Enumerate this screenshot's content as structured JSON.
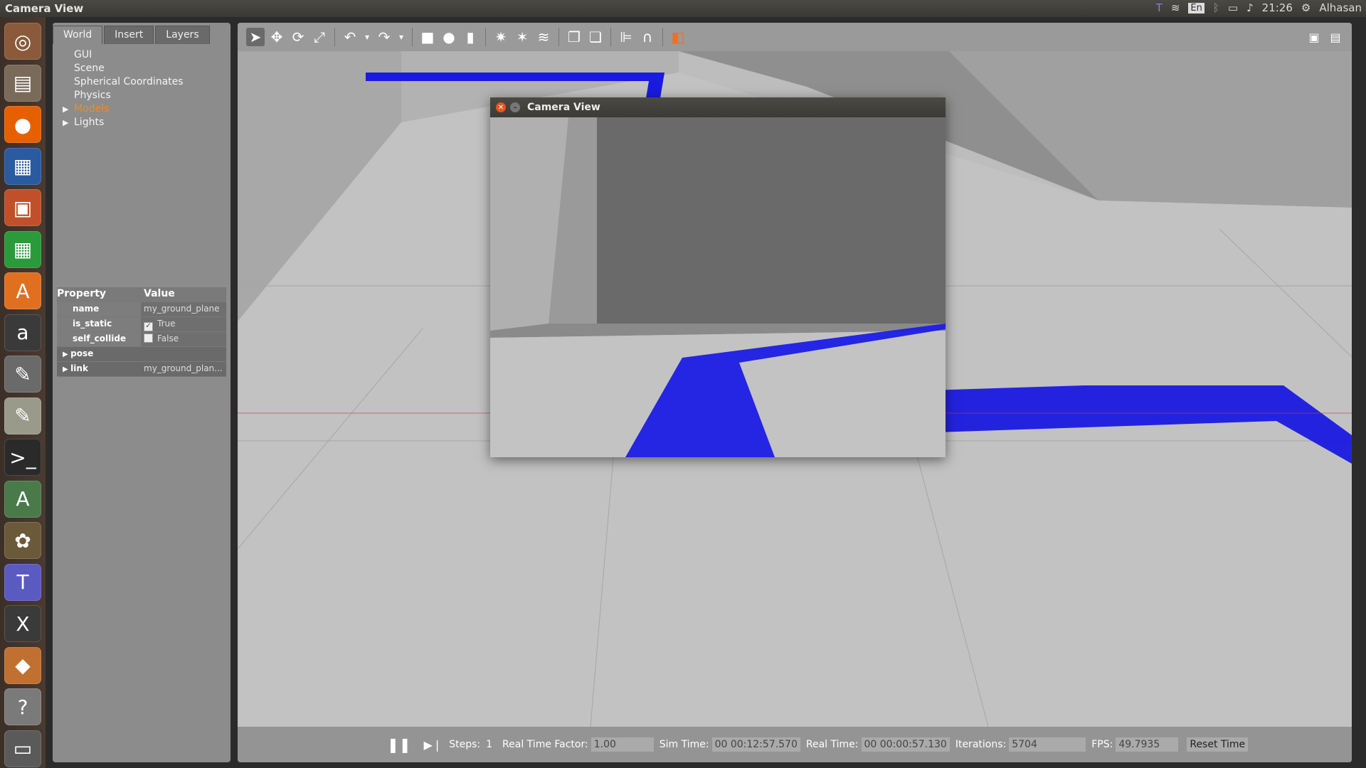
{
  "topbar": {
    "title": "Camera View",
    "language": "En",
    "time": "21:26",
    "user": "Alhasan",
    "icons": [
      "teams-icon",
      "wifi-icon",
      "bluetooth-icon",
      "battery-icon",
      "volume-icon",
      "settings-gear-icon"
    ]
  },
  "launcher": {
    "items": [
      {
        "name": "ubuntu-dash-icon",
        "glyph": "◎",
        "color": "#8a5a3a"
      },
      {
        "name": "files-icon",
        "glyph": "▤",
        "color": "#7a6a5a"
      },
      {
        "name": "firefox-icon",
        "glyph": "●",
        "color": "#e66000"
      },
      {
        "name": "writer-icon",
        "glyph": "▦",
        "color": "#2a5aa0"
      },
      {
        "name": "impress-icon",
        "glyph": "▣",
        "color": "#c0502a"
      },
      {
        "name": "calc-icon",
        "glyph": "▦",
        "color": "#2a9a3a"
      },
      {
        "name": "software-center-icon",
        "glyph": "A",
        "color": "#e07020"
      },
      {
        "name": "amazon-icon",
        "glyph": "a",
        "color": "#3a3a3a"
      },
      {
        "name": "system-settings-icon",
        "glyph": "✎",
        "color": "#6a6a6a"
      },
      {
        "name": "text-editor-icon",
        "glyph": "✎",
        "color": "#9a9a8a"
      },
      {
        "name": "terminal-icon",
        "glyph": ">_",
        "color": "#2a2a2a"
      },
      {
        "name": "software-updater-icon",
        "glyph": "A",
        "color": "#4a7a4a"
      },
      {
        "name": "gimp-icon",
        "glyph": "✿",
        "color": "#6a5a3a"
      },
      {
        "name": "teams-launcher-icon",
        "glyph": "T",
        "color": "#5a5ac0"
      },
      {
        "name": "xterm-icon",
        "glyph": "X",
        "color": "#3a3a3a"
      },
      {
        "name": "gazebo-icon",
        "glyph": "◆",
        "color": "#c07030"
      },
      {
        "name": "help-icon",
        "glyph": "?",
        "color": "#7a7a7a"
      },
      {
        "name": "printer-icon",
        "glyph": "▭",
        "color": "#5a5a5a"
      }
    ]
  },
  "leftpanel": {
    "tabs": [
      "World",
      "Insert",
      "Layers"
    ],
    "tree": [
      {
        "label": "GUI",
        "arrow": false,
        "highlight": false
      },
      {
        "label": "Scene",
        "arrow": false,
        "highlight": false
      },
      {
        "label": "Spherical Coordinates",
        "arrow": false,
        "highlight": false
      },
      {
        "label": "Physics",
        "arrow": false,
        "highlight": false
      },
      {
        "label": "Models",
        "arrow": true,
        "highlight": true
      },
      {
        "label": "Lights",
        "arrow": true,
        "highlight": false
      }
    ],
    "props_header": {
      "property": "Property",
      "value": "Value"
    },
    "props": [
      {
        "name": "name",
        "value": "my_ground_plane",
        "checkbox": null,
        "arrow": false
      },
      {
        "name": "is_static",
        "value": "True",
        "checkbox": true,
        "arrow": false
      },
      {
        "name": "self_collide",
        "value": "False",
        "checkbox": false,
        "arrow": false
      },
      {
        "name": "pose",
        "value": "",
        "checkbox": null,
        "arrow": true
      },
      {
        "name": "link",
        "value": "my_ground_plan...",
        "checkbox": null,
        "arrow": true
      }
    ]
  },
  "toolbar": {
    "tools": [
      {
        "name": "select-mode-icon",
        "glyph": "➤",
        "sel": true
      },
      {
        "name": "translate-mode-icon",
        "glyph": "✥",
        "sel": false
      },
      {
        "name": "rotate-mode-icon",
        "glyph": "⟳",
        "sel": false
      },
      {
        "name": "scale-mode-icon",
        "glyph": "⤢",
        "sel": false
      },
      {
        "name": "sep",
        "glyph": "",
        "sel": false
      },
      {
        "name": "undo-icon",
        "glyph": "↶",
        "sel": false
      },
      {
        "name": "undo-dropdown-icon",
        "glyph": "▾",
        "sel": false
      },
      {
        "name": "redo-icon",
        "glyph": "↷",
        "sel": false
      },
      {
        "name": "redo-dropdown-icon",
        "glyph": "▾",
        "sel": false
      },
      {
        "name": "sep",
        "glyph": "",
        "sel": false
      },
      {
        "name": "box-shape-icon",
        "glyph": "■",
        "sel": false
      },
      {
        "name": "sphere-shape-icon",
        "glyph": "●",
        "sel": false
      },
      {
        "name": "cylinder-shape-icon",
        "glyph": "▮",
        "sel": false
      },
      {
        "name": "sep",
        "glyph": "",
        "sel": false
      },
      {
        "name": "point-light-icon",
        "glyph": "✷",
        "sel": false
      },
      {
        "name": "spot-light-icon",
        "glyph": "✶",
        "sel": false
      },
      {
        "name": "directional-light-icon",
        "glyph": "≋",
        "sel": false
      },
      {
        "name": "sep",
        "glyph": "",
        "sel": false
      },
      {
        "name": "copy-icon",
        "glyph": "❐",
        "sel": false
      },
      {
        "name": "paste-icon",
        "glyph": "❏",
        "sel": false
      },
      {
        "name": "sep",
        "glyph": "",
        "sel": false
      },
      {
        "name": "align-icon",
        "glyph": "⊫",
        "sel": false
      },
      {
        "name": "snap-icon",
        "glyph": "∩",
        "sel": false
      },
      {
        "name": "sep",
        "glyph": "",
        "sel": false
      },
      {
        "name": "view-angle-icon",
        "glyph": "◧",
        "sel": false
      }
    ],
    "right_tools": [
      "screenshot-icon",
      "record-icon"
    ]
  },
  "camera_window": {
    "title": "Camera View"
  },
  "statusbar": {
    "steps_label": "Steps:",
    "steps_value": "1",
    "rtf_label": "Real Time Factor:",
    "rtf_value": "1.00",
    "simtime_label": "Sim Time:",
    "simtime_value": "00 00:12:57.570",
    "realtime_label": "Real Time:",
    "realtime_value": "00 00:00:57.130",
    "iterations_label": "Iterations:",
    "iterations_value": "5704",
    "fps_label": "FPS:",
    "fps_value": "49.7935",
    "reset_label": "Reset Time"
  }
}
